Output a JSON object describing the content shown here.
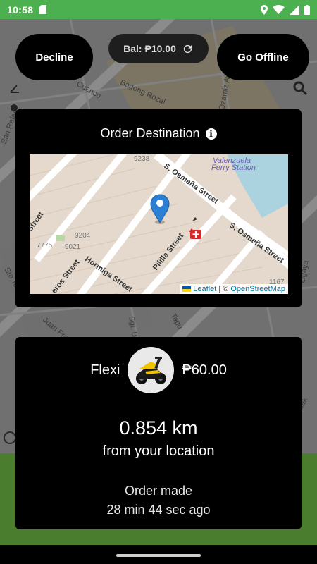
{
  "status_bar": {
    "time": "10:58",
    "icons": [
      "sd-card-icon",
      "location-icon",
      "wifi-icon",
      "signal-icon",
      "battery-icon"
    ]
  },
  "top_bar": {
    "decline_label": "Decline",
    "balance_label": "Bal: ₱10.00",
    "go_offline_label": "Go Offline"
  },
  "background_map": {
    "street_labels": [
      "Bagong Rozal",
      "Cuenco",
      "Ozamiz Ave",
      "San Rafael",
      "Sto Tomas",
      "Juan Francisco St",
      "Sgt. Bo",
      "Tapu",
      "Ligaya",
      "Ldak"
    ]
  },
  "destination_card": {
    "title": "Order Destination",
    "map": {
      "labels": [
        "S. Osmeña Street",
        "S. Osmeña Street",
        "Pililla Street",
        "Hormiga Street",
        "Valenzuela",
        "Ferry Station",
        "9238",
        "9204",
        "9021",
        "7775",
        "1167",
        "Street",
        "eros Street"
      ],
      "attribution_leaflet": "Leaflet",
      "attribution_separator": "| ©",
      "attribution_osm": "OpenStreetMap"
    }
  },
  "order_card": {
    "vehicle_type": "Flexi",
    "fare": "₱60.00",
    "distance": "0.854 km",
    "distance_caption": "from your location",
    "order_made_label": "Order made",
    "order_made_time": "28 min 44 sec ago"
  },
  "colors": {
    "status_bar": "#4caf50",
    "map_pin": "#2b80d6",
    "attribution_link": "#0078a8",
    "hospital_marker": "#d62828"
  }
}
